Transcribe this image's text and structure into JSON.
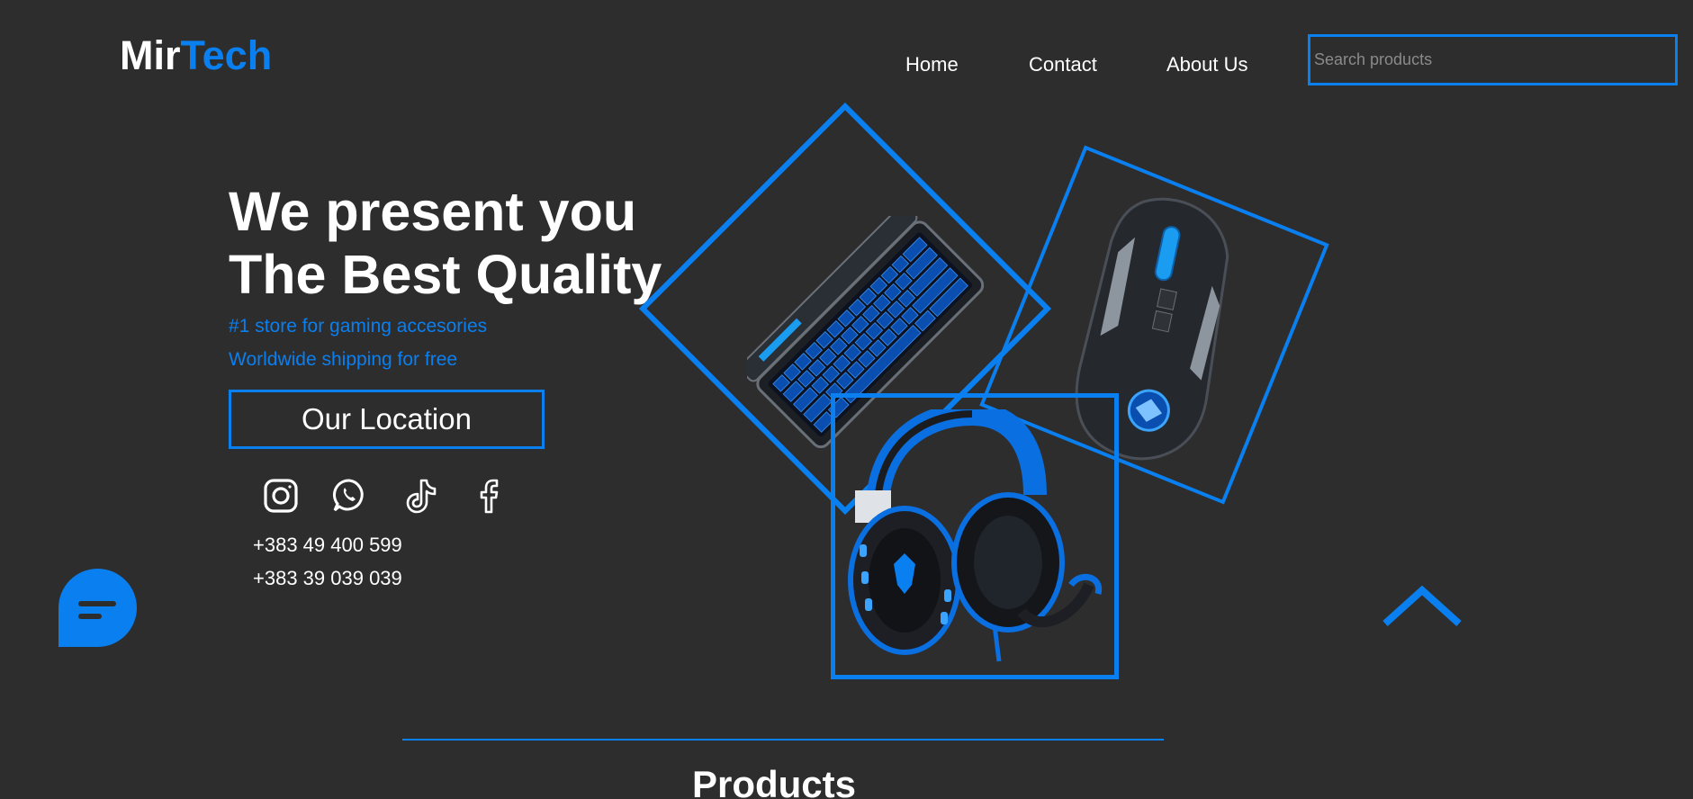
{
  "header": {
    "logo": {
      "part1": "Mir",
      "part2": "Tech"
    },
    "nav": {
      "home": "Home",
      "contact": "Contact",
      "about": "About Us"
    },
    "search": {
      "placeholder": "Search products",
      "value": ""
    }
  },
  "hero": {
    "headline_line1": "We present you",
    "headline_line2": "The Best Quality",
    "tagline1": "#1 store for gaming accesories",
    "tagline2": "Worldwide shipping for free",
    "location_button": "Our Location",
    "social_icons": [
      "instagram-icon",
      "whatsapp-icon",
      "tiktok-icon",
      "facebook-icon"
    ],
    "phones": [
      "+383 49 400 599",
      "+383 39 039 039"
    ]
  },
  "products_section": {
    "title": "Products"
  },
  "colors": {
    "background": "#2d2d2d",
    "accent": "#0a7ff0",
    "text": "#ffffff"
  }
}
